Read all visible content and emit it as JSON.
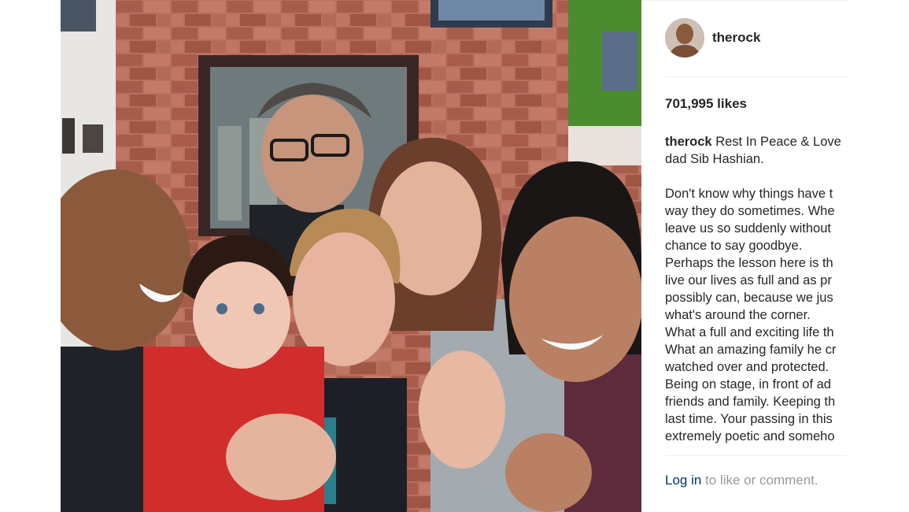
{
  "post": {
    "username": "therock",
    "likes": "701,995 likes",
    "photo_alt": "",
    "caption": {
      "user": "therock",
      "lines": [
        "Rest In Peace & Love",
        "dad Sib Hashian.",
        "",
        "Don't know why things have t",
        "way they do sometimes. Whe",
        "leave us so suddenly without",
        "chance to say goodbye.",
        "Perhaps the lesson here is th",
        "live our lives as full and as pr",
        "possibly can, because we jus",
        "what's around the corner.",
        "What a full and exciting life th",
        "What an amazing family he cr",
        "watched over and protected.",
        "Being on stage, in front of ad",
        "friends and family. Keeping th",
        "last time. Your passing in this",
        "extremely poetic and someho"
      ]
    },
    "login": {
      "link": "Log in",
      "rest": " to like or comment."
    }
  },
  "colors": {
    "link": "#003569",
    "muted": "#999999",
    "text": "#262626",
    "divider": "#efefef"
  }
}
